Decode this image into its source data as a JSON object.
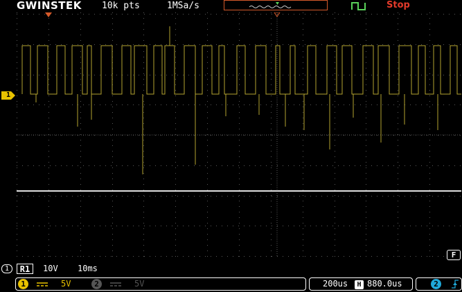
{
  "brand": "GWINSTEK",
  "record_length": "10k pts",
  "sample_rate": "1MSa/s",
  "run_status": "Stop",
  "colors": {
    "ch1": "#b5a530",
    "ch1_badge": "#e8c200",
    "ch2": "#1fa8d8",
    "stop": "#e23a2a",
    "trigger": "#5ad25a",
    "orange": "#d65a2a",
    "grid": "#5a5a5a"
  },
  "ch1_marker": "1",
  "function_key": "F",
  "reference": {
    "slot": "1",
    "name": "R1",
    "volt_scale": "10V",
    "time_scale": "10ms"
  },
  "channels": [
    {
      "badge": "1",
      "coupling_icon": "dc-coupling-icon",
      "scale": "5V",
      "active": true
    },
    {
      "badge": "2",
      "coupling_icon": "dc-coupling-icon",
      "scale": "5V",
      "active": false
    }
  ],
  "timebase": {
    "scale": "200us",
    "position_marker": "H",
    "position": "880.0us"
  },
  "trigger": {
    "source": "2",
    "slope_icon": "rising-edge-icon"
  }
}
